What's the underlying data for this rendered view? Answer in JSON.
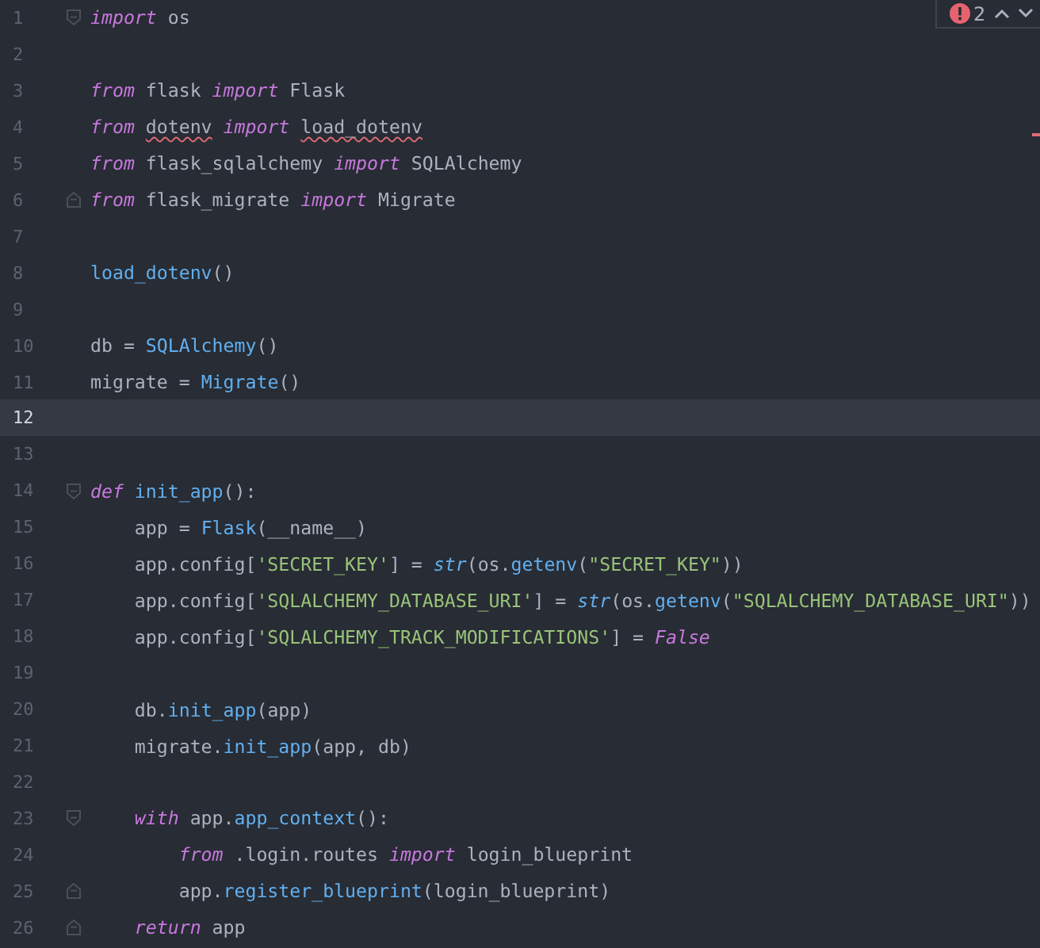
{
  "problems": {
    "count": "2"
  },
  "lines": [
    {
      "n": "1",
      "fold_start": true,
      "current": false,
      "tokens": [
        {
          "t": "import",
          "kind": "kw"
        },
        {
          "t": " os",
          "kind": "plain"
        }
      ]
    },
    {
      "n": "2",
      "current": false
    },
    {
      "n": "3",
      "current": false,
      "tokens": [
        {
          "t": "from",
          "kind": "kw"
        },
        {
          "t": " flask ",
          "kind": "plain"
        },
        {
          "t": "import",
          "kind": "kw"
        },
        {
          "t": " Flask",
          "kind": "plain"
        }
      ]
    },
    {
      "n": "4",
      "current": false,
      "tokens": [
        {
          "t": "from ",
          "kind": "kw"
        },
        {
          "t": "dotenv",
          "kind": "plain",
          "error": true
        },
        {
          "t": " import ",
          "kind": "kw"
        },
        {
          "t": "load_dotenv",
          "kind": "plain",
          "error": true
        }
      ]
    },
    {
      "n": "5",
      "current": false,
      "tokens": [
        {
          "t": "from",
          "kind": "kw"
        },
        {
          "t": " flask_sqlalchemy ",
          "kind": "plain"
        },
        {
          "t": "import",
          "kind": "kw"
        },
        {
          "t": " SQLAlchemy",
          "kind": "plain"
        }
      ]
    },
    {
      "n": "6",
      "fold_end": true,
      "current": false,
      "tokens": [
        {
          "t": "from",
          "kind": "kw"
        },
        {
          "t": " flask_migrate ",
          "kind": "plain"
        },
        {
          "t": "import",
          "kind": "kw"
        },
        {
          "t": " Migrate",
          "kind": "plain"
        }
      ]
    },
    {
      "n": "7",
      "current": false
    },
    {
      "n": "8",
      "current": false,
      "tokens": [
        {
          "t": "load_dotenv",
          "kind": "fn"
        },
        {
          "t": "()",
          "kind": "plain"
        }
      ]
    },
    {
      "n": "9",
      "current": false
    },
    {
      "n": "10",
      "current": false,
      "tokens": [
        {
          "t": "db = ",
          "kind": "plain"
        },
        {
          "t": "SQLAlchemy",
          "kind": "fn"
        },
        {
          "t": "()",
          "kind": "plain"
        }
      ]
    },
    {
      "n": "11",
      "current": false,
      "tokens": [
        {
          "t": "migrate = ",
          "kind": "plain"
        },
        {
          "t": "Migrate",
          "kind": "fn"
        },
        {
          "t": "()",
          "kind": "plain"
        }
      ]
    },
    {
      "n": "12",
      "current": true
    },
    {
      "n": "13",
      "current": false
    },
    {
      "n": "14",
      "fold_start": true,
      "current": false,
      "tokens": [
        {
          "t": "def ",
          "kind": "kw"
        },
        {
          "t": "init_app",
          "kind": "fn"
        },
        {
          "t": "():",
          "kind": "plain"
        }
      ]
    },
    {
      "n": "15",
      "current": false,
      "tokens": [
        {
          "t": "    app = ",
          "kind": "plain"
        },
        {
          "t": "Flask",
          "kind": "fn"
        },
        {
          "t": "(__name__)",
          "kind": "plain"
        }
      ]
    },
    {
      "n": "16",
      "current": false,
      "tokens": [
        {
          "t": "    app.config[",
          "kind": "plain"
        },
        {
          "t": "'SECRET_KEY'",
          "kind": "str"
        },
        {
          "t": "] = ",
          "kind": "plain"
        },
        {
          "t": "str",
          "kind": "builtin"
        },
        {
          "t": "(os.",
          "kind": "plain"
        },
        {
          "t": "getenv",
          "kind": "fn"
        },
        {
          "t": "(",
          "kind": "plain"
        },
        {
          "t": "\"SECRET_KEY\"",
          "kind": "str"
        },
        {
          "t": "))",
          "kind": "plain"
        }
      ]
    },
    {
      "n": "17",
      "current": false,
      "tokens": [
        {
          "t": "    app.config[",
          "kind": "plain"
        },
        {
          "t": "'SQLALCHEMY_DATABASE_URI'",
          "kind": "str"
        },
        {
          "t": "] = ",
          "kind": "plain"
        },
        {
          "t": "str",
          "kind": "builtin"
        },
        {
          "t": "(os.",
          "kind": "plain"
        },
        {
          "t": "getenv",
          "kind": "fn"
        },
        {
          "t": "(",
          "kind": "plain"
        },
        {
          "t": "\"SQLALCHEMY_DATABASE_URI\"",
          "kind": "str"
        },
        {
          "t": "))",
          "kind": "plain"
        }
      ]
    },
    {
      "n": "18",
      "current": false,
      "tokens": [
        {
          "t": "    app.config[",
          "kind": "plain"
        },
        {
          "t": "'SQLALCHEMY_TRACK_MODIFICATIONS'",
          "kind": "str"
        },
        {
          "t": "] = ",
          "kind": "plain"
        },
        {
          "t": "False",
          "kind": "kw"
        }
      ]
    },
    {
      "n": "19",
      "current": false
    },
    {
      "n": "20",
      "current": false,
      "tokens": [
        {
          "t": "    db.",
          "kind": "plain"
        },
        {
          "t": "init_app",
          "kind": "fn"
        },
        {
          "t": "(app)",
          "kind": "plain"
        }
      ]
    },
    {
      "n": "21",
      "current": false,
      "tokens": [
        {
          "t": "    migrate.",
          "kind": "plain"
        },
        {
          "t": "init_app",
          "kind": "fn"
        },
        {
          "t": "(app, db)",
          "kind": "plain"
        }
      ]
    },
    {
      "n": "22",
      "current": false
    },
    {
      "n": "23",
      "fold_start": true,
      "current": false,
      "tokens": [
        {
          "t": "    with",
          "kind": "kw"
        },
        {
          "t": " app.",
          "kind": "plain"
        },
        {
          "t": "app_context",
          "kind": "fn"
        },
        {
          "t": "():",
          "kind": "plain"
        }
      ]
    },
    {
      "n": "24",
      "current": false,
      "tokens": [
        {
          "t": "        from",
          "kind": "kw"
        },
        {
          "t": " .login.routes ",
          "kind": "plain"
        },
        {
          "t": "import",
          "kind": "kw"
        },
        {
          "t": " login_blueprint",
          "kind": "plain"
        }
      ]
    },
    {
      "n": "25",
      "fold_end": true,
      "current": false,
      "tokens": [
        {
          "t": "        app.",
          "kind": "plain"
        },
        {
          "t": "register_blueprint",
          "kind": "fn"
        },
        {
          "t": "(login_blueprint)",
          "kind": "plain"
        }
      ]
    },
    {
      "n": "26",
      "fold_end": true,
      "current": false,
      "tokens": [
        {
          "t": "    return",
          "kind": "kw"
        },
        {
          "t": " app",
          "kind": "plain"
        }
      ]
    }
  ]
}
